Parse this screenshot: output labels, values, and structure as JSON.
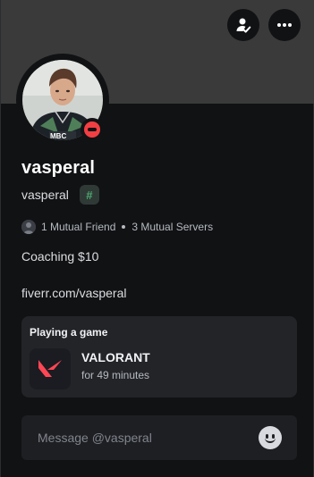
{
  "profile": {
    "display_name": "vasperal",
    "username": "vasperal",
    "badge": "#",
    "status": "dnd",
    "status_color": "#f23f43",
    "avatar_icon": "user-avatar-photo",
    "mutual_friends": "1 Mutual Friend",
    "mutual_servers": "3 Mutual Servers",
    "bio_lines": [
      "Coaching $10",
      "fiverr.com/vasperal"
    ]
  },
  "toolbar": {
    "friend_icon": "add-friend-icon",
    "more_icon": "more-options-icon"
  },
  "activity": {
    "heading": "Playing a game",
    "game_name": "VALORANT",
    "elapsed": "for 49 minutes",
    "game_icon": "valorant-logo-icon",
    "accent": "#ff4655"
  },
  "message": {
    "placeholder": "Message @vasperal",
    "emoji_icon": "emoji-smile-icon"
  },
  "colors": {
    "background": "#111214",
    "banner": "#3a3a3a",
    "card": "#232428",
    "badge_green": "#4ea872"
  }
}
